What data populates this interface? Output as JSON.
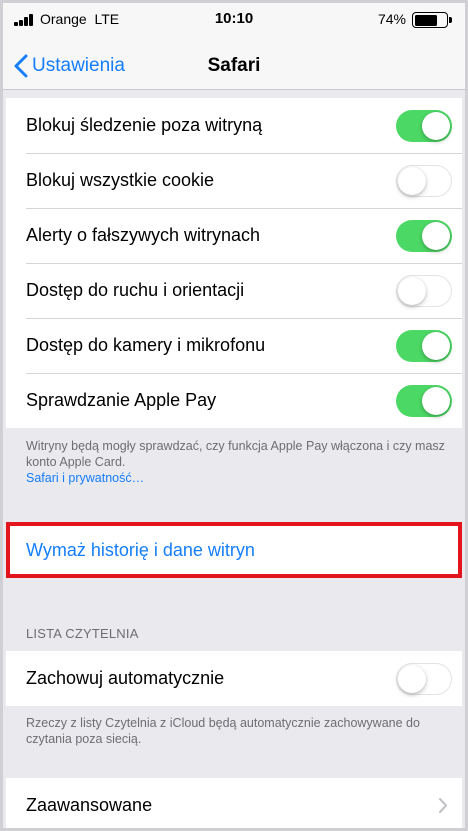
{
  "status_bar": {
    "carrier": "Orange",
    "network": "LTE",
    "time": "10:10",
    "battery": "74%",
    "battery_level": 0.74
  },
  "nav": {
    "back_label": "Ustawienia",
    "title": "Safari"
  },
  "privacy_rows": [
    {
      "label": "Blokuj śledzenie poza witryną",
      "on": true
    },
    {
      "label": "Blokuj wszystkie cookie",
      "on": false
    },
    {
      "label": "Alerty o fałszywych witrynach",
      "on": true
    },
    {
      "label": "Dostęp do ruchu i orientacji",
      "on": false
    },
    {
      "label": "Dostęp do kamery i mikrofonu",
      "on": true
    },
    {
      "label": "Sprawdzanie Apple Pay",
      "on": true
    }
  ],
  "privacy_footer": {
    "text": "Witryny będą mogły sprawdzać, czy funkcja Apple Pay włączona i czy masz konto Apple Card.",
    "link": "Safari i prywatność…"
  },
  "clear_history": "Wymaż historię i dane witryn",
  "reading_list": {
    "header": "LISTA CZYTELNIA",
    "row_label": "Zachowuj automatycznie",
    "row_on": false,
    "footer": "Rzeczy z listy Czytelnia z iCloud będą automatycznie zachowywane do czytania poza siecią."
  },
  "advanced": {
    "label": "Zaawansowane"
  },
  "colors": {
    "accent": "#157efb",
    "toggle_on": "#4cd864",
    "highlight_border": "#e3141b",
    "background": "#e9e9ee"
  }
}
